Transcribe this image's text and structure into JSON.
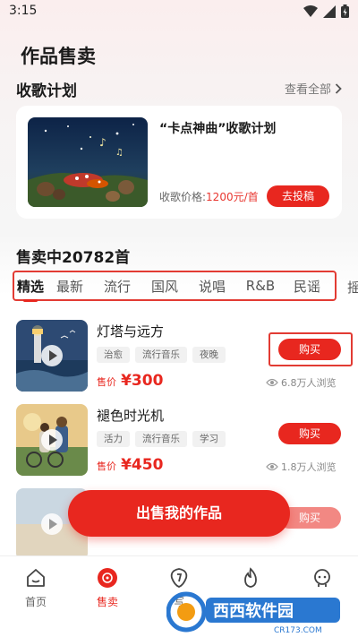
{
  "status": {
    "time": "3:15"
  },
  "page_title": "作品售卖",
  "plan_section": {
    "title": "收歌计划",
    "view_all": "查看全部",
    "card": {
      "title": "“卡点神曲”收歌计划",
      "price_label": "收歌价格:",
      "price_value": "1200元/首",
      "submit_label": "去投稿"
    }
  },
  "sale_title": "售卖中20782首",
  "tabs": [
    "精选",
    "最新",
    "流行",
    "国风",
    "说唱",
    "R&B",
    "民谣"
  ],
  "tab_overflow": "摇",
  "songs": [
    {
      "name": "灯塔与远方",
      "tags": [
        "治愈",
        "流行音乐",
        "夜晚"
      ],
      "price_label": "售价",
      "price": "¥300",
      "buy_label": "购买",
      "views": "6.8万人浏览"
    },
    {
      "name": "褪色时光机",
      "tags": [
        "活力",
        "流行音乐",
        "学习"
      ],
      "price_label": "售价",
      "price": "¥450",
      "buy_label": "购买",
      "views": "1.8万人浏览"
    },
    {
      "buy_label": "购买"
    }
  ],
  "sell_button": "出售我的作品",
  "nav": [
    {
      "label": "首页",
      "icon": "home-icon"
    },
    {
      "label": "售卖",
      "icon": "vinyl-icon"
    },
    {
      "label": "写",
      "icon": "guitar-pick-icon"
    },
    {
      "label": "",
      "icon": "flame-icon"
    },
    {
      "label": "",
      "icon": "character-icon"
    }
  ],
  "watermark": {
    "brand": "西西软件园",
    "url": "CR173.COM"
  },
  "colors": {
    "accent": "#e8271f",
    "highlight_box": "#e23b33"
  }
}
